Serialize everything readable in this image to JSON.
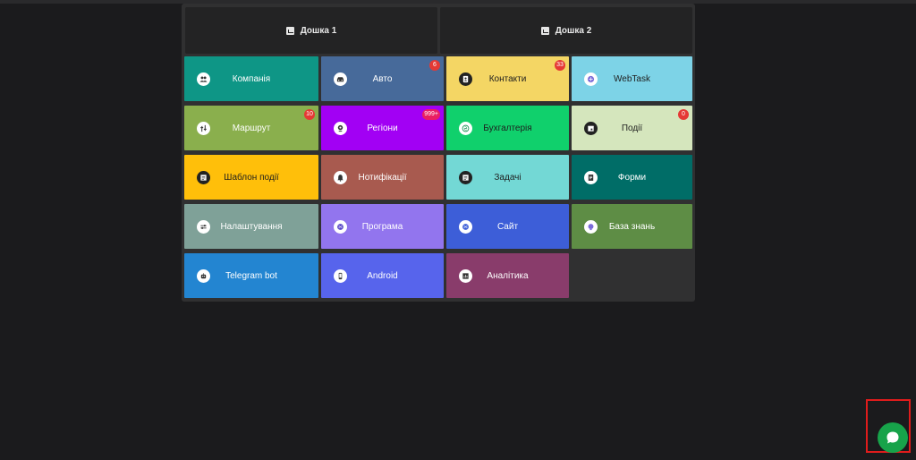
{
  "boards": [
    {
      "label": "Дошка 1",
      "icon": "chart-icon"
    },
    {
      "label": "Дошка 2",
      "icon": "chart-icon"
    }
  ],
  "tiles": [
    {
      "label": "Компанія",
      "icon": "people-icon",
      "color": "#0e9686",
      "badge": null
    },
    {
      "label": "Авто",
      "icon": "car-icon",
      "color": "#476a9a",
      "badge": "6"
    },
    {
      "label": "Контакти",
      "icon": "contact-icon",
      "color": "#f4d664",
      "badge": "33"
    },
    {
      "label": "WebTask",
      "icon": "webtask-icon",
      "color": "#7dd3e7",
      "badge": null
    },
    {
      "label": "Маршрут",
      "icon": "route-icon",
      "color": "#8aaf4d",
      "badge": "10"
    },
    {
      "label": "Регіони",
      "icon": "location-icon",
      "color": "#a200f4",
      "badge": "999+"
    },
    {
      "label": "Бухгалтерія",
      "icon": "accounting-icon",
      "color": "#10d06c",
      "badge": null
    },
    {
      "label": "Події",
      "icon": "calendar-icon",
      "color": "#d5e6bd",
      "badge": "0"
    },
    {
      "label": "Шаблон події",
      "icon": "template-icon",
      "color": "#ffbf0a",
      "badge": null
    },
    {
      "label": "Нотифікації",
      "icon": "bell-icon",
      "color": "#a85a4f",
      "badge": null
    },
    {
      "label": "Задачі",
      "icon": "task-icon",
      "color": "#73d8d5",
      "badge": null
    },
    {
      "label": "Форми",
      "icon": "form-icon",
      "color": "#006d67",
      "badge": null
    },
    {
      "label": "Налаштування",
      "icon": "settings-icon",
      "color": "#7fa198",
      "badge": null
    },
    {
      "label": "Програма",
      "icon": "program-icon",
      "color": "#9275ee",
      "badge": null
    },
    {
      "label": "Сайт",
      "icon": "site-icon",
      "color": "#3d5ed8",
      "badge": null
    },
    {
      "label": "База знань",
      "icon": "knowledge-icon",
      "color": "#5e8d45",
      "badge": null
    },
    {
      "label": "Telegram bot",
      "icon": "bot-icon",
      "color": "#2385d1",
      "badge": null
    },
    {
      "label": "Android",
      "icon": "phone-icon",
      "color": "#5764ec",
      "badge": null
    },
    {
      "label": "Аналітика",
      "icon": "analytics-icon",
      "color": "#893c6b",
      "badge": null
    }
  ],
  "chat": {
    "icon": "chat-bubble-icon",
    "color": "#17a34a"
  }
}
